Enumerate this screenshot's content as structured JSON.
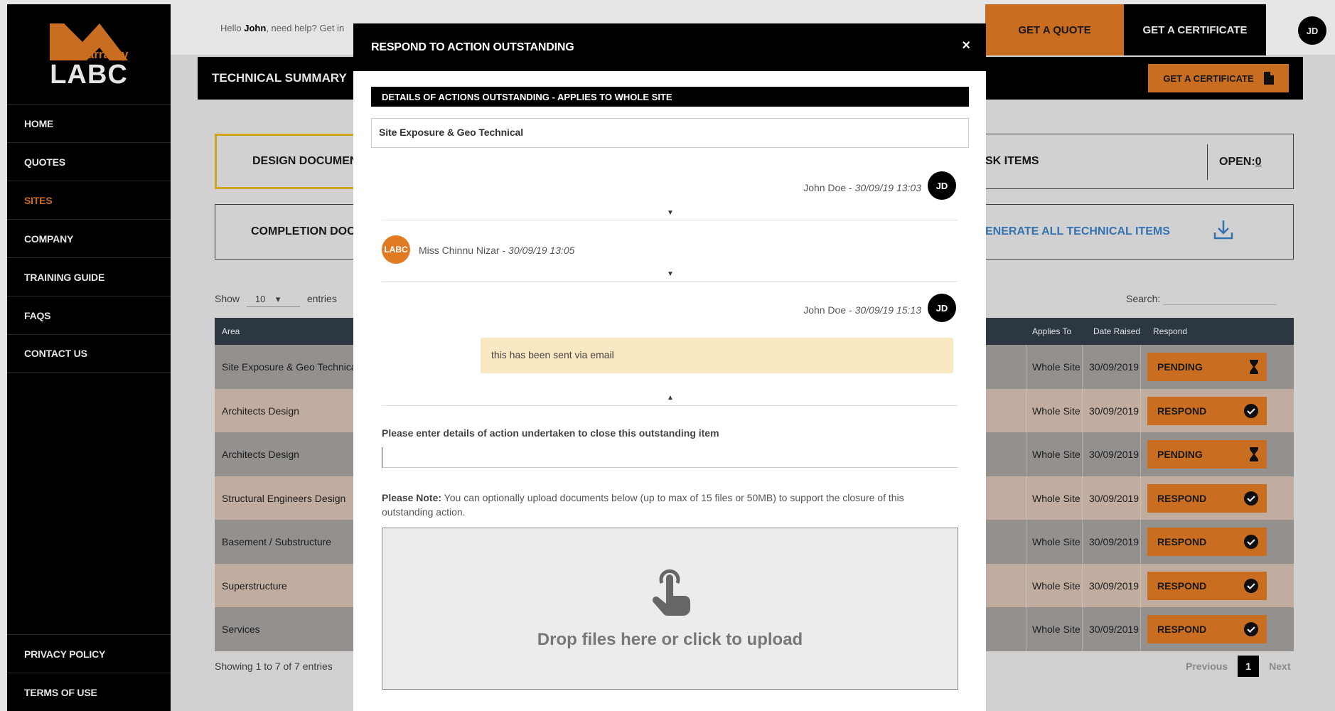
{
  "logo": {
    "small": "warranty",
    "big": "LABC"
  },
  "sidebar": {
    "items": [
      {
        "label": "HOME"
      },
      {
        "label": "QUOTES"
      },
      {
        "label": "SITES"
      },
      {
        "label": "COMPANY"
      },
      {
        "label": "TRAINING GUIDE"
      },
      {
        "label": "FAQS"
      },
      {
        "label": "CONTACT US"
      }
    ],
    "bottom_items": [
      {
        "label": "PRIVACY POLICY"
      },
      {
        "label": "TERMS OF USE"
      }
    ],
    "active_item": "SITES"
  },
  "topbar": {
    "greeting_prefix": "Hello ",
    "user_name": "John",
    "greeting_suffix": ", need help? Get in",
    "quote_label": "GET A QUOTE",
    "cert_label": "GET A CERTIFICATE",
    "avatar_initials": "JD"
  },
  "page": {
    "title": "TECHNICAL SUMMARY",
    "cert_button_label": "GET A CERTIFICATE",
    "cards": {
      "design": "DESIGN DOCUMENT",
      "completion": "COMPLETION DOCS",
      "risk": "SK ITEMS",
      "open_label": "OPEN: ",
      "open_count": "0",
      "generate": "ENERATE ALL TECHNICAL ITEMS"
    },
    "show_label": "Show",
    "entries_value": "10",
    "entries_label": "entries",
    "search_label": "Search:"
  },
  "table": {
    "headers": {
      "area": "Area",
      "applies": "Applies To",
      "date": "Date Raised",
      "respond": "Respond"
    },
    "rows": [
      {
        "area": "Site Exposure & Geo Technica",
        "applies": "Whole Site",
        "date": "30/09/2019",
        "status": "PENDING",
        "icon": "hourglass-icon"
      },
      {
        "area": "Architects Design",
        "applies": "Whole Site",
        "date": "30/09/2019",
        "status": "RESPOND",
        "icon": "check-circle-icon"
      },
      {
        "area": "Architects Design",
        "applies": "Whole Site",
        "date": "30/09/2019",
        "status": "PENDING",
        "icon": "hourglass-icon"
      },
      {
        "area": "Structural Engineers Design",
        "applies": "Whole Site",
        "date": "30/09/2019",
        "status": "RESPOND",
        "icon": "check-circle-icon"
      },
      {
        "area": "Basement / Substructure",
        "applies": "Whole Site",
        "date": "30/09/2019",
        "status": "RESPOND",
        "icon": "check-circle-icon"
      },
      {
        "area": "Superstructure",
        "applies": "Whole Site",
        "date": "30/09/2019",
        "status": "RESPOND",
        "icon": "check-circle-icon"
      },
      {
        "area": "Services",
        "applies": "Whole Site",
        "date": "30/09/2019",
        "status": "RESPOND",
        "icon": "check-circle-icon"
      }
    ],
    "footer_info": "Showing 1 to 7 of 7 entries",
    "pager": {
      "prev": "Previous",
      "page": "1",
      "next": "Next"
    }
  },
  "modal": {
    "title": "RESPOND TO ACTION OUTSTANDING",
    "close": "×",
    "details_header": "DETAILS OF ACTIONS OUTSTANDING - APPLIES TO WHOLE SITE",
    "details_value": "Site Exposure & Geo Technical",
    "messages": [
      {
        "author": "John Doe",
        "sep": " - ",
        "time": "30/09/19 13:03",
        "initials": "JD"
      },
      {
        "author": "Miss Chinnu Nizar",
        "sep": " - ",
        "time": "30/09/19 13:05",
        "initials": "LABC"
      },
      {
        "author": "John Doe",
        "sep": " - ",
        "time": "30/09/19 15:13",
        "initials": "JD",
        "text": "this has been sent via email"
      }
    ],
    "input_label": "Please enter details of action undertaken to close this outstanding item",
    "input_value": "",
    "note_bold": "Please Note:",
    "note_text": " You can optionally upload documents below (up to max of 15 files or 50MB) to support the closure of this outstanding action.",
    "dropzone_text": "Drop files here or click to upload"
  },
  "colors": {
    "brand": "#e07b24",
    "dark": "#000000",
    "header": "#323e4a"
  }
}
